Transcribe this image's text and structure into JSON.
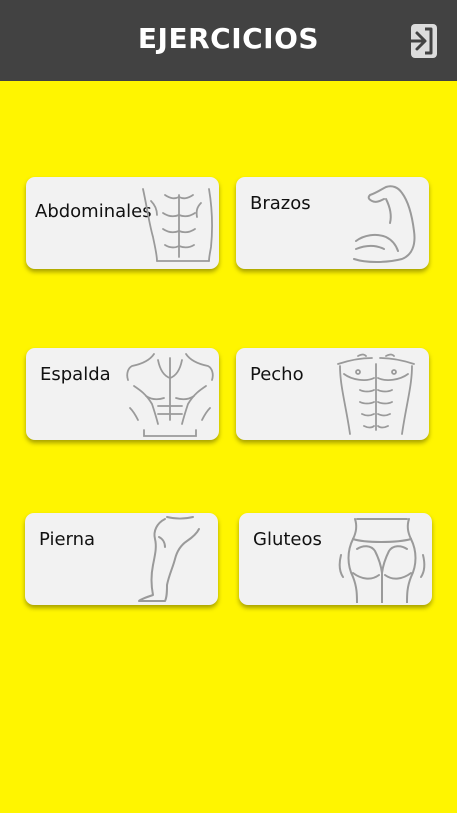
{
  "header": {
    "title": "EJERCICIOS",
    "logout_icon": "logout-icon"
  },
  "colors": {
    "background": "#fff500",
    "header": "#424242",
    "card": "#f2f2f2",
    "illustration_stroke": "#9a9a9a"
  },
  "categories": [
    {
      "label": "Abdominales",
      "icon": "abs-icon"
    },
    {
      "label": "Brazos",
      "icon": "biceps-icon"
    },
    {
      "label": "Espalda",
      "icon": "back-icon"
    },
    {
      "label": "Pecho",
      "icon": "chest-icon"
    },
    {
      "label": "Pierna",
      "icon": "leg-icon"
    },
    {
      "label": "Gluteos",
      "icon": "glutes-icon"
    }
  ]
}
